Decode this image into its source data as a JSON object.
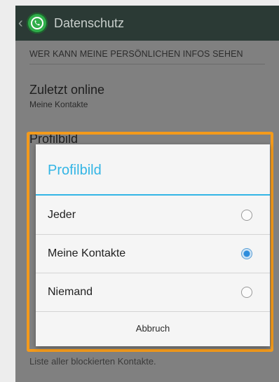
{
  "actionbar": {
    "back_icon": "chevron-left-icon",
    "app_icon": "whatsapp-icon",
    "title": "Datenschutz"
  },
  "section": {
    "header": "WER KANN MEINE PERSÖNLICHEN INFOS SEHEN"
  },
  "preferences": [
    {
      "title": "Zuletzt online",
      "subtitle": "Meine Kontakte"
    },
    {
      "title": "Profilbild"
    }
  ],
  "background_footer": "Liste aller blockierten Kontakte.",
  "dialog": {
    "title": "Profilbild",
    "options": [
      {
        "label": "Jeder",
        "selected": false
      },
      {
        "label": "Meine Kontakte",
        "selected": true
      },
      {
        "label": "Niemand",
        "selected": false
      }
    ],
    "cancel_label": "Abbruch"
  },
  "colors": {
    "accent": "#33b5e5",
    "highlight": "#f39a1b",
    "actionbar": "#2b3a35",
    "brand": "#2fae4a"
  }
}
